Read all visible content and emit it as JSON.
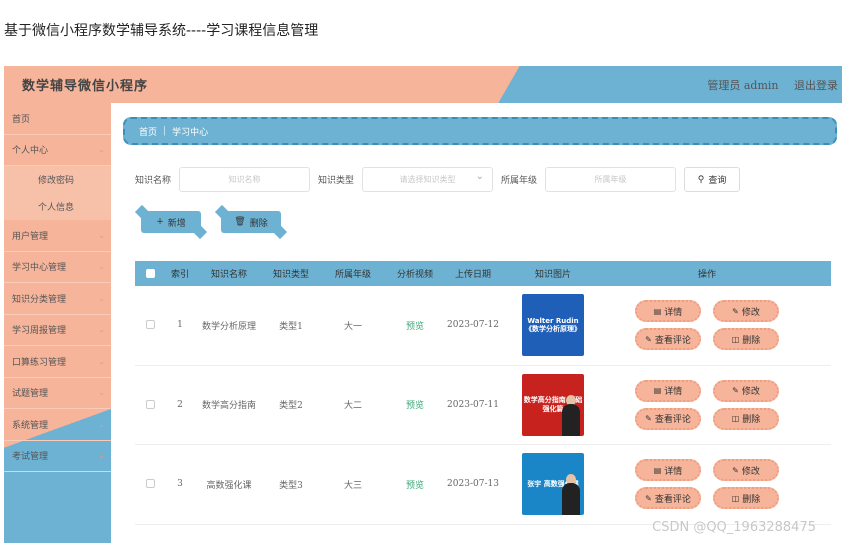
{
  "doc_title": "基于微信小程序数学辅导系统----学习课程信息管理",
  "app": {
    "title": "数学辅导微信小程序",
    "user_label": "管理员 admin",
    "logout_label": "退出登录"
  },
  "sidebar": {
    "items": [
      {
        "label": "首页",
        "chevron": ""
      },
      {
        "label": "个人中心",
        "chevron": "⌄"
      },
      {
        "label": "修改密码",
        "chevron": ""
      },
      {
        "label": "个人信息",
        "chevron": ""
      },
      {
        "label": "用户管理",
        "chevron": "⌄"
      },
      {
        "label": "学习中心管理",
        "chevron": "⌄"
      },
      {
        "label": "知识分类管理",
        "chevron": "⌄"
      },
      {
        "label": "学习周报管理",
        "chevron": "⌄"
      },
      {
        "label": "口算练习管理",
        "chevron": "⌄"
      },
      {
        "label": "试题管理",
        "chevron": "⌄"
      },
      {
        "label": "系统管理",
        "chevron": "⌄"
      },
      {
        "label": "考试管理",
        "chevron": "⌄"
      }
    ]
  },
  "breadcrumb": {
    "home": "首页",
    "sep": "|",
    "current": "学习中心"
  },
  "search": {
    "name_label": "知识名称",
    "name_placeholder": "知识名称",
    "type_label": "知识类型",
    "type_placeholder": "请选择知识类型",
    "grade_label": "所属年级",
    "grade_placeholder": "所属年级",
    "query_label": "查询",
    "query_icon": "search-icon"
  },
  "actions": {
    "add_label": "新增",
    "add_icon": "plus-icon",
    "delete_label": "删除",
    "delete_icon": "trash-icon"
  },
  "table": {
    "headers": [
      "索引",
      "知识名称",
      "知识类型",
      "所属年级",
      "分析视频",
      "上传日期",
      "知识图片",
      "操作"
    ],
    "rows": [
      {
        "index": "1",
        "name": "数学分析原理",
        "type": "类型1",
        "grade": "大一",
        "video": "预览",
        "date": "2023-07-12",
        "img_title": "Walter Rudin《数学分析原理》",
        "img_color": "#1f5fb8"
      },
      {
        "index": "2",
        "name": "数学高分指南",
        "type": "类型2",
        "grade": "大二",
        "video": "预览",
        "date": "2023-07-11",
        "img_title": "数学高分指南 基础强化篇",
        "img_color": "#c8221e"
      },
      {
        "index": "3",
        "name": "高数强化课",
        "type": "类型3",
        "grade": "大三",
        "video": "预览",
        "date": "2023-07-13",
        "img_title": "张宇 高数强化课",
        "img_color": "#1a86c7"
      }
    ],
    "ops": {
      "detail": "详情",
      "edit": "修改",
      "comments": "查看评论",
      "delete": "删除"
    }
  },
  "watermark": "CSDN @QQ_1963288475"
}
